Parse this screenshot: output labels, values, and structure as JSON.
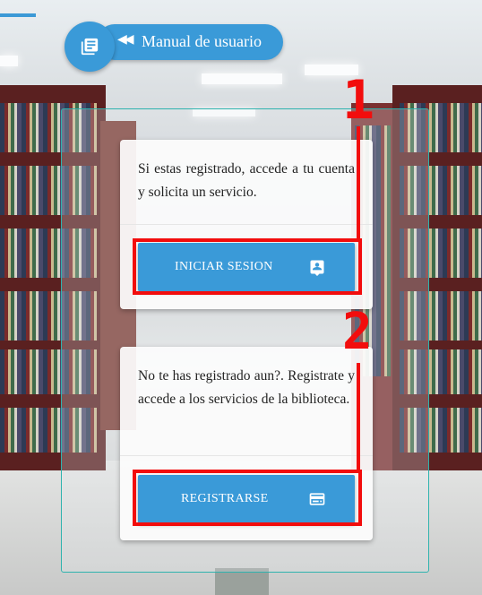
{
  "manual_button": {
    "label": "Manual de usuario",
    "rewind_glyph": "◀◀",
    "book_icon": "library-books-icon"
  },
  "login_card": {
    "text": "Si estas registrado, accede a tu cuenta y solicita un servicio.",
    "button_label": "INICIAR SESION",
    "button_icon": "account-box-icon"
  },
  "register_card": {
    "text": "No te has registrado aun?. Registrate y accede a los servicios de la biblioteca.",
    "button_label": "REGISTRARSE",
    "button_icon": "id-card-icon"
  },
  "annotations": {
    "marker_1": "1",
    "marker_2": "2"
  },
  "colors": {
    "accent": "#3a9ad8",
    "frame": "#2fb3ae",
    "annotation": "#f20d0d"
  }
}
